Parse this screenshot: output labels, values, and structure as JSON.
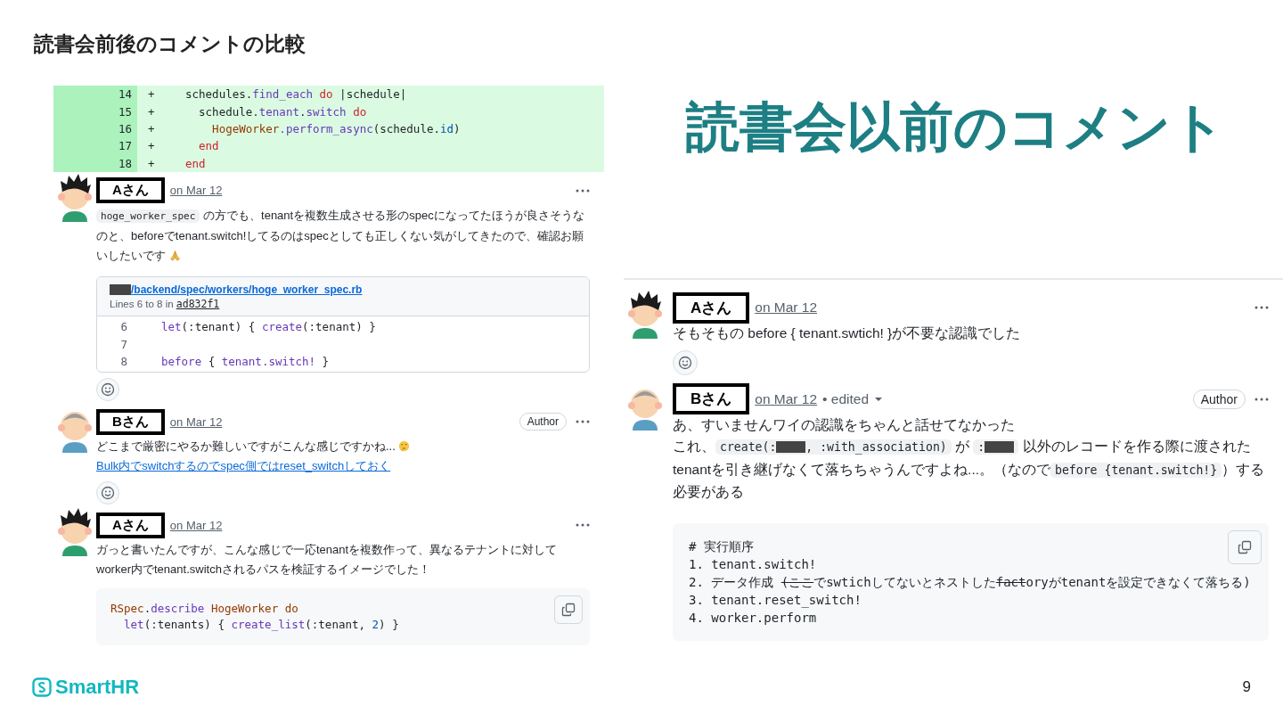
{
  "slide_title": "読書会前後のコメントの比較",
  "heading": "読書会以前のコメント",
  "panels": [
    {
      "diff": [
        {
          "number": "14",
          "marker": "+",
          "tokens": [
            {
              "text": "schedules.",
              "kind": "plain"
            },
            {
              "text": "find_each",
              "kind": "method"
            },
            {
              "text": " do",
              "kind": "keyword"
            },
            {
              "text": " |schedule|",
              "kind": "plain"
            }
          ]
        },
        {
          "number": "15",
          "marker": "+",
          "tokens": [
            {
              "text": "  schedule.",
              "kind": "plain"
            },
            {
              "text": "tenant",
              "kind": "method"
            },
            {
              "text": ".",
              "kind": "plain"
            },
            {
              "text": "switch",
              "kind": "method"
            },
            {
              "text": " do",
              "kind": "keyword"
            }
          ]
        },
        {
          "number": "16",
          "marker": "+",
          "tokens": [
            {
              "text": "    HogeWorker",
              "kind": "constant"
            },
            {
              "text": ".perform_async",
              "kind": "method"
            },
            {
              "text": "(schedule.",
              "kind": "plain"
            },
            {
              "text": "id",
              "kind": "number"
            },
            {
              "text": ")",
              "kind": "plain"
            }
          ]
        },
        {
          "number": "17",
          "marker": "+",
          "tokens": [
            {
              "text": "  end",
              "kind": "keyword"
            }
          ]
        },
        {
          "number": "18",
          "marker": "+",
          "tokens": [
            {
              "text": "end",
              "kind": "keyword"
            }
          ]
        }
      ],
      "comments": [
        {
          "avatar": {
            "kind": "spiky-hair"
          },
          "author": "Aさん",
          "date": "on Mar 12",
          "blocks": [
            {
              "kind": "paragraph",
              "spans": [
                {
                  "kind": "code",
                  "tokens": [
                    {
                      "text": "hoge_worker_spec",
                      "kind": "plain"
                    }
                  ]
                },
                {
                  "kind": "text",
                  "text": " の方でも、tenantを複数生成させる形のspecになってたほうが良さそうなのと、beforeでtenant.switch!してるのはspecとしても正しくない気がしてきたので、確認お願いしたいです "
                },
                {
                  "kind": "pray"
                }
              ]
            },
            {
              "kind": "reference",
              "path": "/backend/spec/workers/hoge_worker_spec.rb",
              "meta": "Lines 6 to 8 in",
              "commit": "ad832f1",
              "lines": [
                {
                  "number": "6",
                  "tokens": [
                    {
                      "text": "let",
                      "kind": "method"
                    },
                    {
                      "text": "(:tenant) { ",
                      "kind": "plain"
                    },
                    {
                      "text": "create",
                      "kind": "method"
                    },
                    {
                      "text": "(:tenant) }",
                      "kind": "plain"
                    }
                  ]
                },
                {
                  "number": "7"
                },
                {
                  "number": "8",
                  "tokens": [
                    {
                      "text": "before",
                      "kind": "method"
                    },
                    {
                      "text": " { ",
                      "kind": "plain"
                    },
                    {
                      "text": "tenant.switch!",
                      "kind": "method"
                    },
                    {
                      "text": " }",
                      "kind": "plain"
                    }
                  ]
                }
              ]
            },
            {
              "kind": "reaction"
            }
          ]
        },
        {
          "avatar": {
            "kind": "bald"
          },
          "author": "Bさん",
          "date": "on Mar 12",
          "badge": "Author",
          "blocks": [
            {
              "kind": "paragraph",
              "spans": [
                {
                  "kind": "text",
                  "text": "どこまで厳密にやるか難しいですがこんな感じですかね... "
                },
                {
                  "kind": "thinking"
                }
              ]
            },
            {
              "kind": "link",
              "text": "Bulk内でswitchするのでspec側ではreset_switchしておく"
            },
            {
              "kind": "reaction"
            }
          ]
        },
        {
          "avatar": {
            "kind": "spiky-hair"
          },
          "author": "Aさん",
          "date": "on Mar 12",
          "blocks": [
            {
              "kind": "paragraph",
              "spans": [
                {
                  "kind": "text",
                  "text": "ガっと書いたんですが、こんな感じで一応tenantを複数作って、異なるテナントに対してworker内でtenant.switchされるパスを検証するイメージでした！"
                }
              ]
            },
            {
              "kind": "code",
              "lines": [
                [
                  {
                    "text": "RSpec",
                    "kind": "constant"
                  },
                  {
                    "text": ".",
                    "kind": "plain"
                  },
                  {
                    "text": "describe",
                    "kind": "method"
                  },
                  {
                    "text": " HogeWorker do",
                    "kind": "constant"
                  }
                ],
                [
                  {
                    "text": "  let",
                    "kind": "method"
                  },
                  {
                    "text": "(:tenants) { ",
                    "kind": "plain"
                  },
                  {
                    "text": "create_list",
                    "kind": "method"
                  },
                  {
                    "text": "(:tenant, ",
                    "kind": "plain"
                  },
                  {
                    "text": "2",
                    "kind": "number"
                  },
                  {
                    "text": ") }",
                    "kind": "plain"
                  }
                ]
              ]
            }
          ]
        }
      ]
    },
    {
      "comments": [
        {
          "avatar": {
            "kind": "spiky-hair"
          },
          "author": "Aさん",
          "date": "on Mar 12",
          "blocks": [
            {
              "kind": "paragraph",
              "spans": [
                {
                  "kind": "text",
                  "text": "そもそもの before { tenant.swtich! }が不要な認識でした"
                }
              ]
            },
            {
              "kind": "reaction"
            }
          ]
        },
        {
          "avatar": {
            "kind": "bald"
          },
          "author": "Bさん",
          "date": "on Mar 12",
          "edited": "• edited",
          "badge": "Author",
          "blocks": [
            {
              "kind": "paragraph",
              "spans": [
                {
                  "kind": "text",
                  "text": "あ、すいませんワイの認識をちゃんと話せてなかった"
                }
              ]
            },
            {
              "kind": "paragraph",
              "spans": [
                {
                  "kind": "text",
                  "text": "これ、"
                },
                {
                  "kind": "code",
                  "tokens": [
                    {
                      "text": "create(:",
                      "kind": "plain"
                    },
                    {
                      "kind": "redacted"
                    },
                    {
                      "text": ", :with_association)",
                      "kind": "plain"
                    }
                  ]
                },
                {
                  "kind": "text",
                  "text": " が "
                },
                {
                  "kind": "code",
                  "tokens": [
                    {
                      "text": ":",
                      "kind": "plain"
                    },
                    {
                      "kind": "redacted"
                    }
                  ]
                },
                {
                  "kind": "text",
                  "text": " 以外のレコードを作る際に渡されたtenantを引き継げなくて落ちちゃうんですよね...。（なので"
                },
                {
                  "kind": "code",
                  "tokens": [
                    {
                      "text": "before {tenant.switch!}",
                      "kind": "plain"
                    }
                  ]
                },
                {
                  "kind": "text",
                  "text": "）する必要がある"
                }
              ]
            },
            {
              "kind": "code",
              "lines": [
                [
                  {
                    "text": "# 実行順序",
                    "kind": "plain"
                  }
                ],
                [
                  {
                    "text": "1. tenant.switch!",
                    "kind": "plain"
                  }
                ],
                [
                  {
                    "text": "2. データ作成 ",
                    "kind": "plain"
                  },
                  {
                    "text": "(ここ",
                    "kind": "struck"
                  },
                  {
                    "text": "でswtichしてないとネストした",
                    "kind": "plain"
                  },
                  {
                    "text": "fact",
                    "kind": "struck"
                  },
                  {
                    "text": "oryがtenantを設定できなくて落ちる)",
                    "kind": "plain"
                  }
                ],
                [
                  {
                    "text": "3. tenant.reset_switch!",
                    "kind": "plain"
                  }
                ],
                [
                  {
                    "text": "4. worker.perform",
                    "kind": "plain"
                  }
                ]
              ]
            }
          ]
        }
      ]
    }
  ],
  "logo": "SmartHR",
  "page_number": "9"
}
